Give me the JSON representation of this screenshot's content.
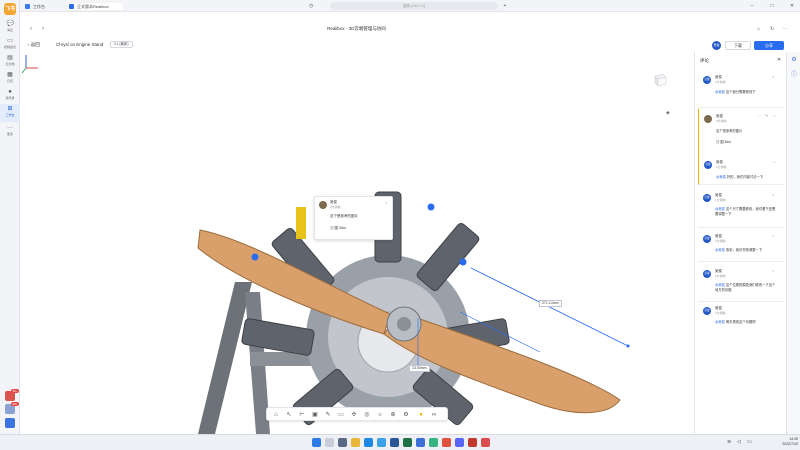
{
  "rail": {
    "logo": "飞书",
    "items": [
      {
        "label": "消息",
        "icon": "chat-icon"
      },
      {
        "label": "视频会议",
        "icon": "video-icon"
      },
      {
        "label": "云文档",
        "icon": "doc-icon"
      },
      {
        "label": "日历",
        "icon": "calendar-icon"
      },
      {
        "label": "通讯录",
        "icon": "contacts-icon"
      },
      {
        "label": "工作台",
        "icon": "workbench-icon"
      },
      {
        "label": "更多",
        "icon": "more-icon"
      }
    ],
    "badges": [
      "99+",
      "99+"
    ]
  },
  "titlebar": {
    "tab1": "工作台",
    "tab2": "正式版本Realibox",
    "search_placeholder": "搜索 (Ctrl + K)"
  },
  "document": {
    "title": "Realibox - 3D云端管理与协同",
    "back_label": "返回",
    "file_name": "Chrysl on Engine Stand",
    "version": "V1 (最新)"
  },
  "actions": {
    "download": "下载",
    "share": "分享",
    "avatar": "吴俊"
  },
  "viewport": {
    "measure_long": "271.14mm",
    "measure_short": "13.00mm",
    "pin_comment": {
      "name": "吴俊",
      "time": "2分钟前",
      "text": "这个是参考的图片",
      "attachment": "图.3dm"
    }
  },
  "panel": {
    "title": "评论",
    "comments": [
      {
        "name": "吴俊",
        "time": "1分钟前",
        "text_mention": "@吴俊",
        "text": " 这个部分需要修改下"
      },
      {
        "name": "吴俊",
        "time": "2分钟前",
        "text": "这个是参考的图片",
        "attachment": "图.3dm"
      },
      {
        "name": "吴俊",
        "time": "1分钟前",
        "text_mention": "@吴俊",
        "text": " 好的，我们内部讨论一下"
      },
      {
        "name": "吴俊",
        "time": "1分钟前",
        "text_mention": "@吴俊 ",
        "text": "这个尺寸需要修改，我们看下还需要调整一下"
      },
      {
        "name": "吴俊",
        "time": "1分钟前",
        "text_mention": "@吴俊",
        "text": " 收到，我们尽快调整一下"
      },
      {
        "name": "吴俊",
        "time": "1分钟前",
        "text_mention": "@吴俊",
        "text": " 这个位置的模型我们修改一下这个地方的问题"
      },
      {
        "name": "吴俊",
        "time": "1分钟前",
        "text_mention": "@吴俊",
        "text": " 明天再改这个问题吧"
      }
    ]
  },
  "taskbar": {
    "time": "14:49",
    "date": "2022/7/20"
  },
  "colors": {
    "accent": "#2a6cf0",
    "propeller": "#d9a06b",
    "highlight": "#f0b400"
  }
}
